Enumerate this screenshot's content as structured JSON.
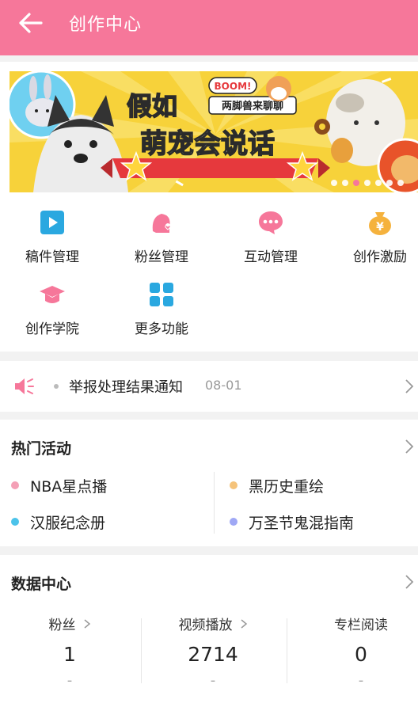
{
  "header": {
    "title": "创作中心",
    "back_icon": "back-arrow-icon",
    "bg_color": "#f6779a"
  },
  "banner": {
    "text_main": "假如萌宠会说话",
    "text_boom": "BOOM!",
    "text_sub": "两脚兽来聊聊",
    "slide_count": 7,
    "active_slide": 3
  },
  "grid": [
    {
      "label": "稿件管理",
      "icon": "play-video-icon",
      "color": "#2aa8e0"
    },
    {
      "label": "粉丝管理",
      "icon": "fan-heart-icon",
      "color": "#f6779a"
    },
    {
      "label": "互动管理",
      "icon": "chat-bubble-icon",
      "color": "#f6779a"
    },
    {
      "label": "创作激励",
      "icon": "money-bag-icon",
      "color": "#f5b23d"
    },
    {
      "label": "创作学院",
      "icon": "graduation-cap-icon",
      "color": "#f6779a"
    },
    {
      "label": "更多功能",
      "icon": "more-grid-icon",
      "color": "#2aa8e0"
    }
  ],
  "notice": {
    "icon": "speaker-icon",
    "text": "举报处理结果通知",
    "date": "08-01"
  },
  "hot": {
    "title": "热门活动",
    "items": [
      {
        "label": "NBA星点播",
        "color": "#f4a0b6"
      },
      {
        "label": "黑历史重绘",
        "color": "#f5c37a"
      },
      {
        "label": "汉服纪念册",
        "color": "#4cc3ea"
      },
      {
        "label": "万圣节鬼混指南",
        "color": "#9fa8f5"
      }
    ]
  },
  "data_center": {
    "title": "数据中心",
    "stats": [
      {
        "label": "粉丝",
        "value": "1",
        "delta": "-",
        "has_arrow": true
      },
      {
        "label": "视频播放",
        "value": "2714",
        "delta": "-",
        "has_arrow": true
      },
      {
        "label": "专栏阅读",
        "value": "0",
        "delta": "-",
        "has_arrow": false
      }
    ]
  }
}
